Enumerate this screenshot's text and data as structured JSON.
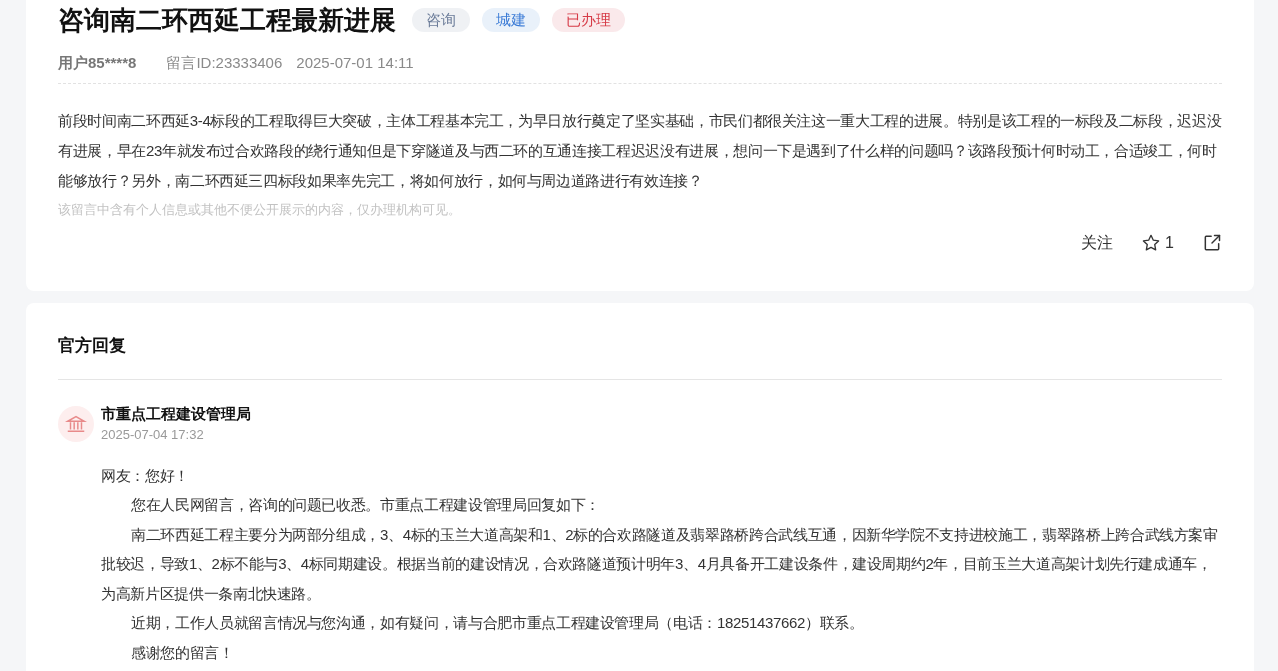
{
  "question": {
    "title": "咨询南二环西延工程最新进展",
    "tags": [
      {
        "label": "咨询",
        "color": "#6b7c99"
      },
      {
        "label": "城建",
        "color": "#3b7bd6"
      },
      {
        "label": "已办理",
        "color": "#d63b47"
      }
    ],
    "user": "用户85****8",
    "message_id": "留言ID:23333406",
    "time": "2025-07-01 14:11",
    "body": "前段时间南二环西延3-4标段的工程取得巨大突破，主体工程基本完工，为早日放行奠定了坚实基础，市民们都很关注这一重大工程的进展。特别是该工程的一标段及二标段，迟迟没有进展，早在23年就发布过合欢路段的绕行通知但是下穿隧道及与西二环的互通连接工程迟迟没有进展，想问一下是遇到了什么样的问题吗？该路段预计何时动工，合适竣工，何时能够放行？另外，南二环西延三四标段如果率先完工，将如何放行，如何与周边道路进行有效连接？",
    "notice": "该留言中含有个人信息或其他不便公开展示的内容，仅办理机构可见。",
    "follow_label": "关注",
    "likes": "1"
  },
  "reply": {
    "heading": "官方回复",
    "agency": "市重点工程建设管理局",
    "time": "2025-07-04 17:32",
    "paragraphs": [
      {
        "text": "网友：您好！",
        "indented": false
      },
      {
        "text": "您在人民网留言，咨询的问题已收悉。市重点工程建设管理局回复如下：",
        "indented": true
      },
      {
        "text": "南二环西延工程主要分为两部分组成，3、4标的玉兰大道高架和1、2标的合欢路隧道及翡翠路桥跨合武线互通，因新华学院不支持进校施工，翡翠路桥上跨合武线方案审批较迟，导致1、2标不能与3、4标同期建设。根据当前的建设情况，合欢路隧道预计明年3、4月具备开工建设条件，建设周期约2年，目前玉兰大道高架计划先行建成通车，为高新片区提供一条南北快速路。",
        "indented": true
      },
      {
        "text": "近期，工作人员就留言情况与您沟通，如有疑问，请与合肥市重点工程建设管理局（电话：18251437662）联系。",
        "indented": true
      },
      {
        "text": "感谢您的留言！",
        "indented": true
      }
    ]
  }
}
